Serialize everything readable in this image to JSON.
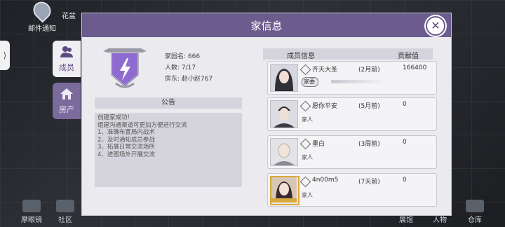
{
  "background": {
    "mail_label": "邮件通知",
    "map_label": "花盆",
    "bottom_items": [
      "摩眼镜",
      "社区",
      "展馆",
      "人物",
      "仓库"
    ]
  },
  "side_tabs": [
    {
      "label": "成员",
      "icon": "people-icon"
    },
    {
      "label": "房产",
      "icon": "house-icon"
    }
  ],
  "modal": {
    "title": "家信息",
    "close_icon": "close-icon"
  },
  "family": {
    "name_label": "家园名:",
    "name_value": "666",
    "members_label": "人数:",
    "members_value": "7/17",
    "owner_label": "房东:",
    "owner_value": "赵小赵767"
  },
  "notice": {
    "title": "公告",
    "lines": [
      "创建家成功!",
      "组建沟通渠道可更加方便进行交流",
      "1、准确布置局内战术",
      "2、及时通知成员参战",
      "3、拓展日常交流场所",
      "4、进图场外开展交流"
    ]
  },
  "member_list": {
    "header_members": "成员信息",
    "header_contrib": "贡献值",
    "members": [
      {
        "name": "齐天大圣",
        "time": "(2月前)",
        "contrib": "166400",
        "role": "家委",
        "avatar": "female-avatar"
      },
      {
        "name": "愿你平安",
        "time": "(5月前)",
        "contrib": "0",
        "role": "家人",
        "avatar": "male-avatar"
      },
      {
        "name": "墨白",
        "time": "(3周前)",
        "contrib": "0",
        "role": "家人",
        "avatar": "bald-male-avatar"
      },
      {
        "name": "4n00m5",
        "time": "(7天前)",
        "contrib": "0",
        "role": "家人",
        "avatar": "female-avatar-framed"
      }
    ]
  },
  "colors": {
    "header": "#6c5c8e",
    "emblem": "#8e6bd1",
    "panel": "#eaeaef"
  }
}
